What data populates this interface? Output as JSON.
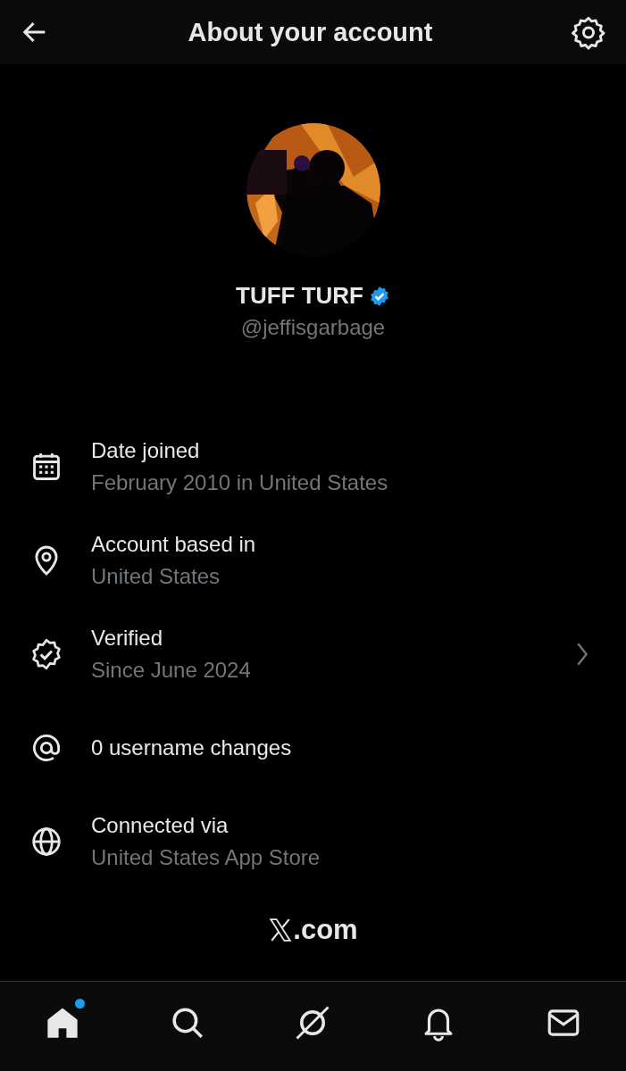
{
  "header": {
    "title": "About your account"
  },
  "profile": {
    "name": "TUFF TURF",
    "verified": true,
    "handle": "@jeffisgarbage"
  },
  "rows": [
    {
      "title": "Date joined",
      "subtitle": "February 2010 in United States",
      "chevron": false
    },
    {
      "title": "Account based in",
      "subtitle": "United States",
      "chevron": false
    },
    {
      "title": "Verified",
      "subtitle": "Since June 2024",
      "chevron": true
    },
    {
      "title": "0 username changes",
      "chevron": false
    },
    {
      "title": "Connected via",
      "subtitle": "United States App Store",
      "chevron": false
    }
  ],
  "footer": {
    "text": ".com"
  },
  "nav": [
    {
      "selected": true,
      "dot": true
    },
    {
      "selected": false,
      "dot": false
    },
    {
      "selected": false,
      "dot": false
    },
    {
      "selected": false,
      "dot": false
    },
    {
      "selected": false,
      "dot": false
    }
  ]
}
